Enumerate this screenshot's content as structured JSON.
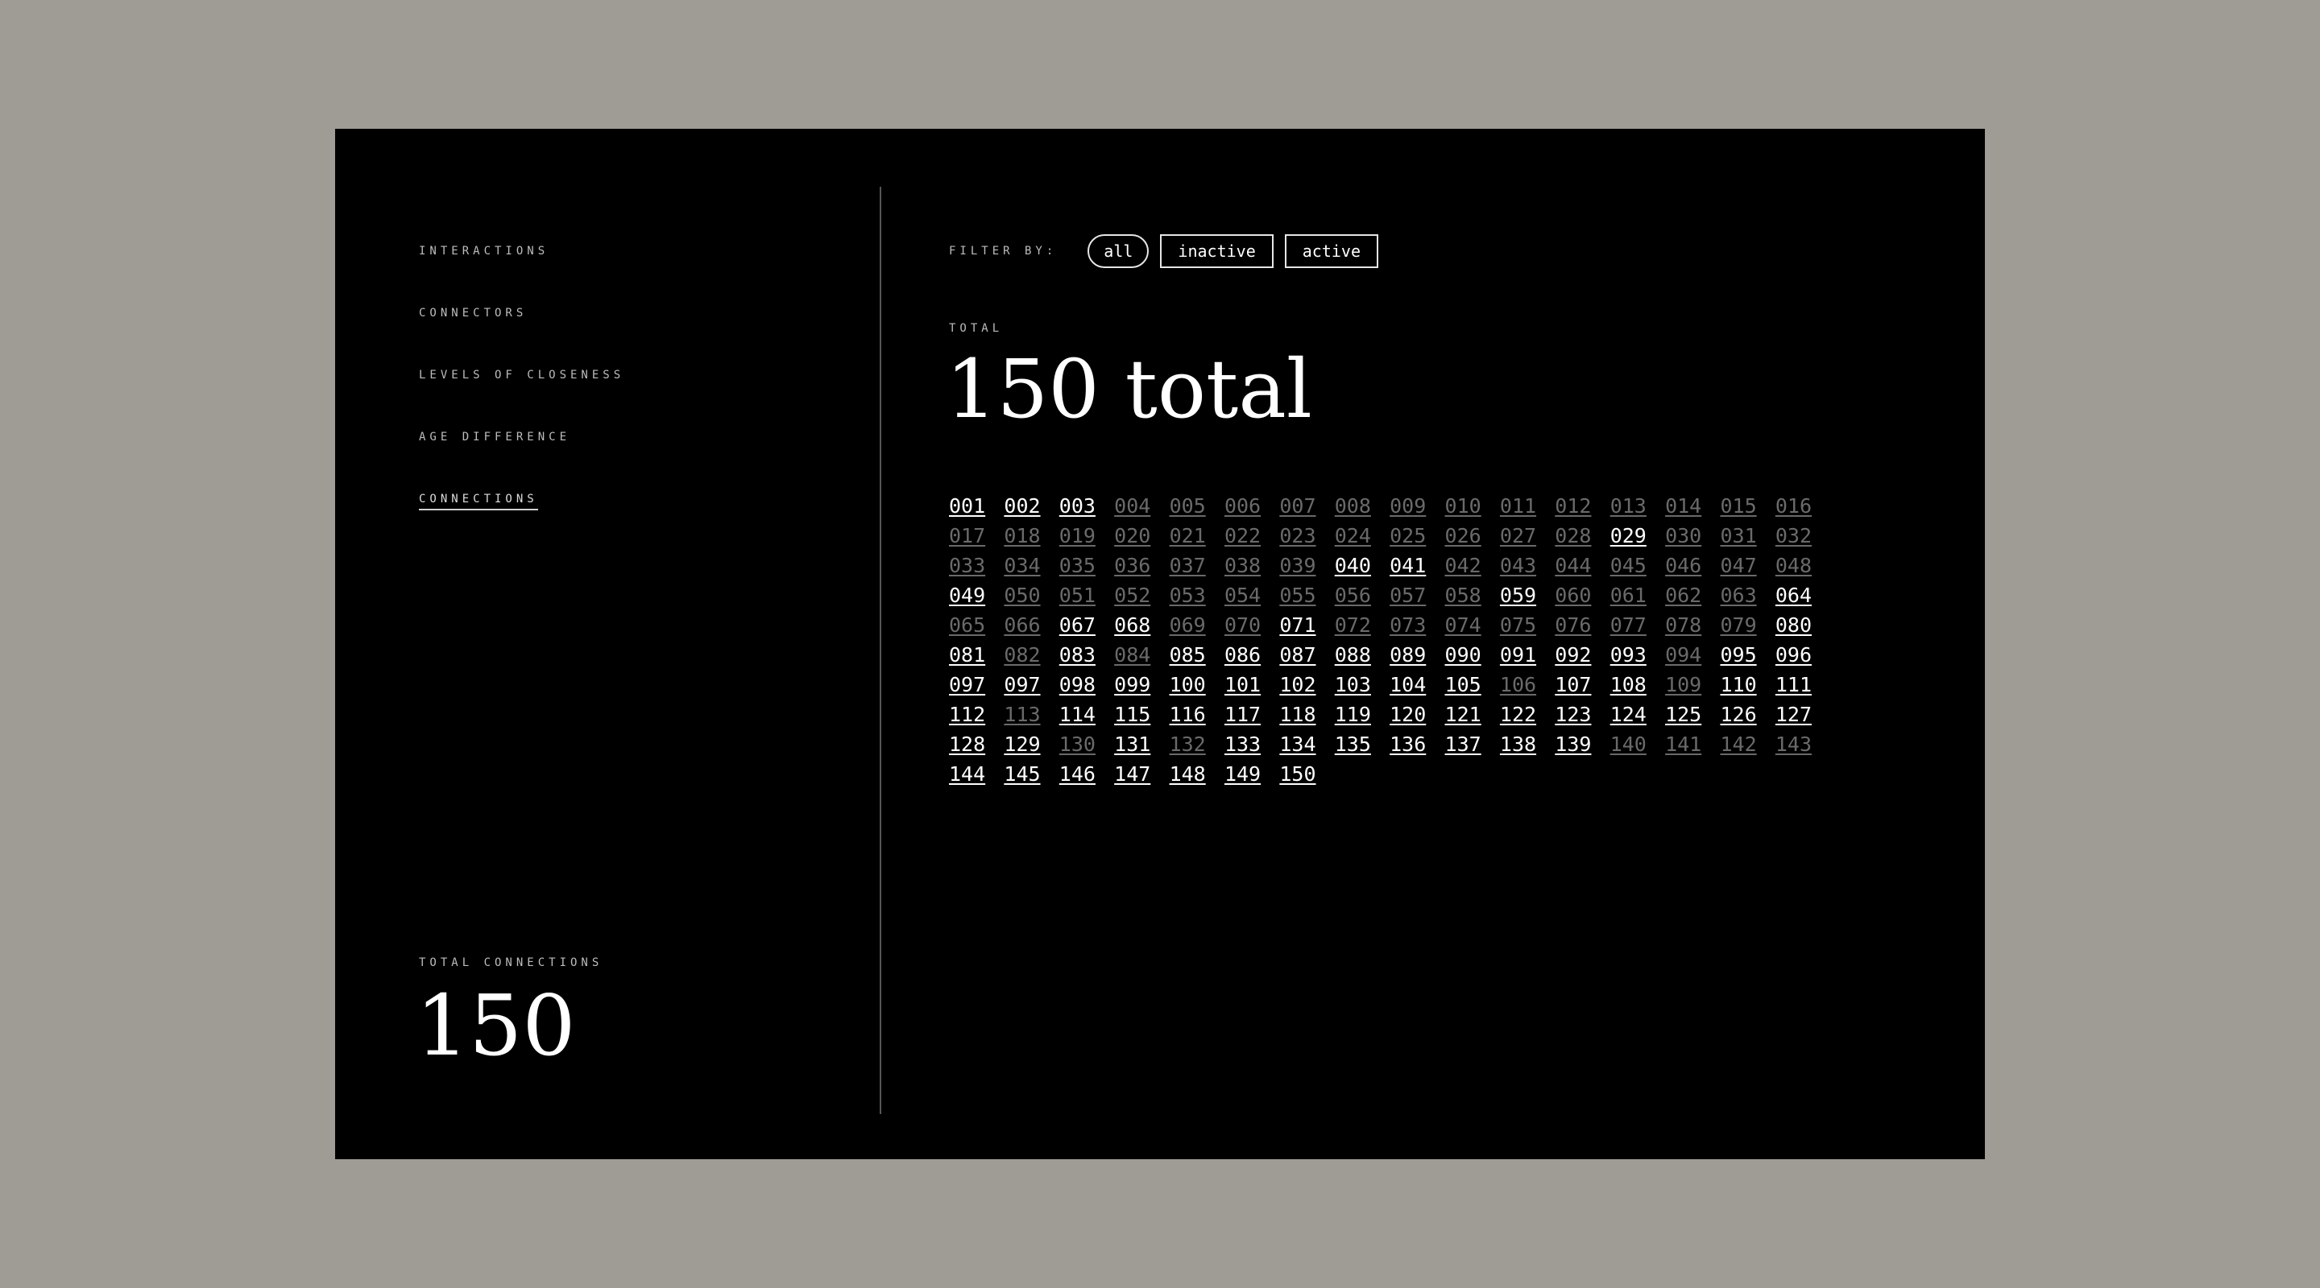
{
  "sidebar": {
    "items": [
      {
        "label": "INTERACTIONS",
        "active": false
      },
      {
        "label": "CONNECTORS",
        "active": false
      },
      {
        "label": "LEVELS OF CLOSENESS",
        "active": false
      },
      {
        "label": "AGE DIFFERENCE",
        "active": false
      },
      {
        "label": "CONNECTIONS",
        "active": true
      }
    ],
    "total_label": "TOTAL CONNECTIONS",
    "total_value": "150"
  },
  "filter": {
    "label": "FILTER BY:",
    "options": [
      {
        "label": "all",
        "selected": true
      },
      {
        "label": "inactive",
        "selected": false
      },
      {
        "label": "active",
        "selected": false
      }
    ]
  },
  "total": {
    "label": "TOTAL",
    "headline": "150 total"
  },
  "connections": [
    {
      "id": "001",
      "active": true
    },
    {
      "id": "002",
      "active": true
    },
    {
      "id": "003",
      "active": true
    },
    {
      "id": "004",
      "active": false
    },
    {
      "id": "005",
      "active": false
    },
    {
      "id": "006",
      "active": false
    },
    {
      "id": "007",
      "active": false
    },
    {
      "id": "008",
      "active": false
    },
    {
      "id": "009",
      "active": false
    },
    {
      "id": "010",
      "active": false
    },
    {
      "id": "011",
      "active": false
    },
    {
      "id": "012",
      "active": false
    },
    {
      "id": "013",
      "active": false
    },
    {
      "id": "014",
      "active": false
    },
    {
      "id": "015",
      "active": false
    },
    {
      "id": "016",
      "active": false
    },
    {
      "id": "017",
      "active": false
    },
    {
      "id": "018",
      "active": false
    },
    {
      "id": "019",
      "active": false
    },
    {
      "id": "020",
      "active": false
    },
    {
      "id": "021",
      "active": false
    },
    {
      "id": "022",
      "active": false
    },
    {
      "id": "023",
      "active": false
    },
    {
      "id": "024",
      "active": false
    },
    {
      "id": "025",
      "active": false
    },
    {
      "id": "026",
      "active": false
    },
    {
      "id": "027",
      "active": false
    },
    {
      "id": "028",
      "active": false
    },
    {
      "id": "029",
      "active": true
    },
    {
      "id": "030",
      "active": false
    },
    {
      "id": "031",
      "active": false
    },
    {
      "id": "032",
      "active": false
    },
    {
      "id": "033",
      "active": false
    },
    {
      "id": "034",
      "active": false
    },
    {
      "id": "035",
      "active": false
    },
    {
      "id": "036",
      "active": false
    },
    {
      "id": "037",
      "active": false
    },
    {
      "id": "038",
      "active": false
    },
    {
      "id": "039",
      "active": false
    },
    {
      "id": "040",
      "active": true
    },
    {
      "id": "041",
      "active": true
    },
    {
      "id": "042",
      "active": false
    },
    {
      "id": "043",
      "active": false
    },
    {
      "id": "044",
      "active": false
    },
    {
      "id": "045",
      "active": false
    },
    {
      "id": "046",
      "active": false
    },
    {
      "id": "047",
      "active": false
    },
    {
      "id": "048",
      "active": false
    },
    {
      "id": "049",
      "active": true
    },
    {
      "id": "050",
      "active": false
    },
    {
      "id": "051",
      "active": false
    },
    {
      "id": "052",
      "active": false
    },
    {
      "id": "053",
      "active": false
    },
    {
      "id": "054",
      "active": false
    },
    {
      "id": "055",
      "active": false
    },
    {
      "id": "056",
      "active": false
    },
    {
      "id": "057",
      "active": false
    },
    {
      "id": "058",
      "active": false
    },
    {
      "id": "059",
      "active": true
    },
    {
      "id": "060",
      "active": false
    },
    {
      "id": "061",
      "active": false
    },
    {
      "id": "062",
      "active": false
    },
    {
      "id": "063",
      "active": false
    },
    {
      "id": "064",
      "active": true
    },
    {
      "id": "065",
      "active": false
    },
    {
      "id": "066",
      "active": false
    },
    {
      "id": "067",
      "active": true
    },
    {
      "id": "068",
      "active": true
    },
    {
      "id": "069",
      "active": false
    },
    {
      "id": "070",
      "active": false
    },
    {
      "id": "071",
      "active": true
    },
    {
      "id": "072",
      "active": false
    },
    {
      "id": "073",
      "active": false
    },
    {
      "id": "074",
      "active": false
    },
    {
      "id": "075",
      "active": false
    },
    {
      "id": "076",
      "active": false
    },
    {
      "id": "077",
      "active": false
    },
    {
      "id": "078",
      "active": false
    },
    {
      "id": "079",
      "active": false
    },
    {
      "id": "080",
      "active": true
    },
    {
      "id": "081",
      "active": true
    },
    {
      "id": "082",
      "active": false
    },
    {
      "id": "083",
      "active": true
    },
    {
      "id": "084",
      "active": false
    },
    {
      "id": "085",
      "active": true
    },
    {
      "id": "086",
      "active": true
    },
    {
      "id": "087",
      "active": true
    },
    {
      "id": "088",
      "active": true
    },
    {
      "id": "089",
      "active": true
    },
    {
      "id": "090",
      "active": true
    },
    {
      "id": "091",
      "active": true
    },
    {
      "id": "092",
      "active": true
    },
    {
      "id": "093",
      "active": true
    },
    {
      "id": "094",
      "active": false
    },
    {
      "id": "095",
      "active": true
    },
    {
      "id": "096",
      "active": true
    },
    {
      "id": "097",
      "active": true
    },
    {
      "id": "097",
      "active": true
    },
    {
      "id": "098",
      "active": true
    },
    {
      "id": "099",
      "active": true
    },
    {
      "id": "100",
      "active": true
    },
    {
      "id": "101",
      "active": true
    },
    {
      "id": "102",
      "active": true
    },
    {
      "id": "103",
      "active": true
    },
    {
      "id": "104",
      "active": true
    },
    {
      "id": "105",
      "active": true
    },
    {
      "id": "106",
      "active": false
    },
    {
      "id": "107",
      "active": true
    },
    {
      "id": "108",
      "active": true
    },
    {
      "id": "109",
      "active": false
    },
    {
      "id": "110",
      "active": true
    },
    {
      "id": "111",
      "active": true
    },
    {
      "id": "112",
      "active": true
    },
    {
      "id": "113",
      "active": false
    },
    {
      "id": "114",
      "active": true
    },
    {
      "id": "115",
      "active": true
    },
    {
      "id": "116",
      "active": true
    },
    {
      "id": "117",
      "active": true
    },
    {
      "id": "118",
      "active": true
    },
    {
      "id": "119",
      "active": true
    },
    {
      "id": "120",
      "active": true
    },
    {
      "id": "121",
      "active": true
    },
    {
      "id": "122",
      "active": true
    },
    {
      "id": "123",
      "active": true
    },
    {
      "id": "124",
      "active": true
    },
    {
      "id": "125",
      "active": true
    },
    {
      "id": "126",
      "active": true
    },
    {
      "id": "127",
      "active": true
    },
    {
      "id": "128",
      "active": true
    },
    {
      "id": "129",
      "active": true
    },
    {
      "id": "130",
      "active": false
    },
    {
      "id": "131",
      "active": true
    },
    {
      "id": "132",
      "active": false
    },
    {
      "id": "133",
      "active": true
    },
    {
      "id": "134",
      "active": true
    },
    {
      "id": "135",
      "active": true
    },
    {
      "id": "136",
      "active": true
    },
    {
      "id": "137",
      "active": true
    },
    {
      "id": "138",
      "active": true
    },
    {
      "id": "139",
      "active": true
    },
    {
      "id": "140",
      "active": false
    },
    {
      "id": "141",
      "active": false
    },
    {
      "id": "142",
      "active": false
    },
    {
      "id": "143",
      "active": false
    },
    {
      "id": "144",
      "active": true
    },
    {
      "id": "145",
      "active": true
    },
    {
      "id": "146",
      "active": true
    },
    {
      "id": "147",
      "active": true
    },
    {
      "id": "148",
      "active": true
    },
    {
      "id": "149",
      "active": true
    },
    {
      "id": "150",
      "active": true
    }
  ]
}
